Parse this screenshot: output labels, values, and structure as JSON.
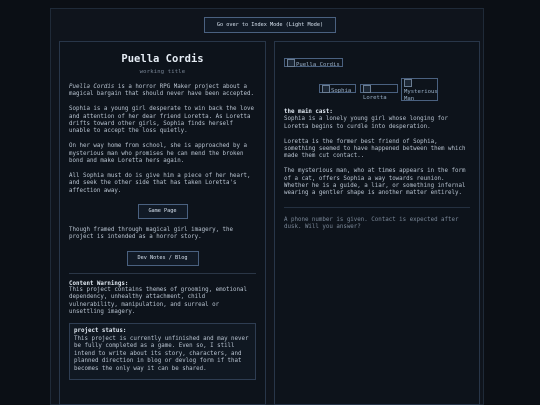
{
  "top_button": "Go over to Index Mode (Light Mode)",
  "left": {
    "title": "Puella Cordis",
    "subtitle": "working title",
    "intro_em": "Puella Cordis",
    "intro_rest": " is a horror RPG Maker project about a magical bargain that should never have been accepted.",
    "para2": "Sophia is a young girl desperate to win back the love and attention of her dear friend Loretta. As Loretta drifts toward other girls, Sophia finds herself unable to accept the loss quietly.",
    "para3": "On her way home from school, she is approached by a mysterious man who promises he can mend the broken bond and make Loretta hers again.",
    "para4": "All Sophia must do is give him a piece of her heart, and seek the other side that has taken Loretta's affection away.",
    "game_button": "Game Page",
    "para5": "Though framed through magical girl imagery, the project is intended as a horror story.",
    "dev_button": "Dev Notes / Blog",
    "warnings_heading": "Content Warnings:",
    "warnings_text": "This project contains themes of grooming, emotional dependency, unhealthy attachment, child vulnerability, manipulation, and surreal or unsettling imagery.",
    "status_heading": "project status:",
    "status_text": "This project is currently unfinished and may never be fully completed as a game. Even so, I still intend to write about its story, characters, and planned direction in blog or devlog form if that becomes the only way it can be shared."
  },
  "right": {
    "logo_alt": "Puella Cordis",
    "characters": [
      "Sophia",
      "Loretta",
      "Mysterious Man"
    ],
    "cast_heading": "the main cast:",
    "cast_sophia": "Sophia is a lonely young girl whose longing for Loretta begins to curdle into desperation.",
    "cast_loretta": "Loretta is the former best friend of Sophia, something seemed to have happened between them which made them cut contact..",
    "cast_man": "The mysterious man, who at times appears in the form of a cat, offers Sophia a way towards reunion. Whether he is a guide, a liar, or something infernal wearing a gentler shape is another matter entirely.",
    "phone_note": "A phone number is given. Contact is expected after dusk. Will you answer?"
  },
  "icons": {
    "broken_image": "broken-image-icon"
  },
  "colors": {
    "background": "#0b0f15",
    "panel": "#0d131b",
    "border": "#4a6180",
    "text": "#b9c4d1"
  }
}
